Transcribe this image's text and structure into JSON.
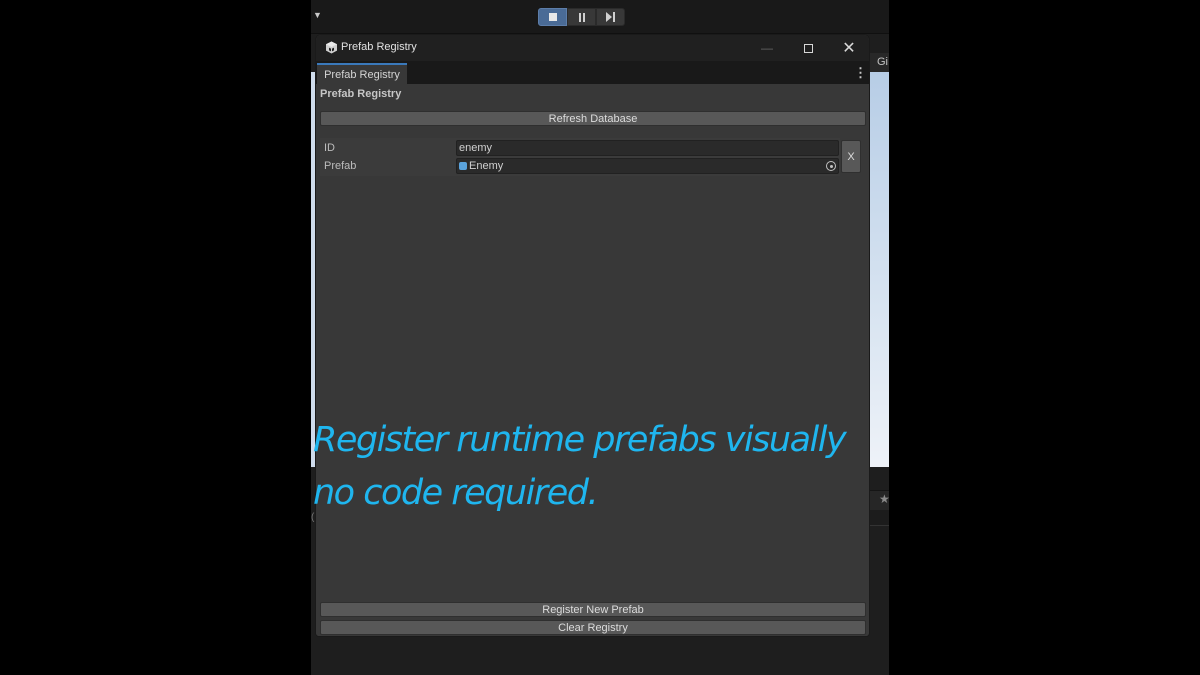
{
  "editor": {
    "toolbar": {
      "dropdown_icon": "caret-down-icon",
      "play_controls": [
        "stop-icon",
        "pause-icon",
        "step-icon"
      ]
    },
    "game_tab_label": "Gi",
    "lower_icon": "star-icon"
  },
  "window": {
    "title": "Prefab Registry",
    "title_icon": "prefab-cubes-icon",
    "controls": [
      "minimize-icon",
      "maximize-icon",
      "close-icon"
    ],
    "tab_label": "Prefab Registry",
    "menu_icon": "kebab-menu-icon"
  },
  "panel": {
    "heading": "Prefab Registry",
    "refresh_label": "Refresh Database",
    "entries": [
      {
        "id_label": "ID",
        "id_value": "enemy",
        "prefab_label": "Prefab",
        "prefab_value": "Enemy",
        "remove_label": "X"
      }
    ],
    "register_label": "Register New Prefab",
    "clear_label": "Clear Registry"
  },
  "tagline": {
    "line1": "Register runtime prefabs visually",
    "line2": "no code required."
  },
  "colors": {
    "tagline": "#1fb6ef",
    "window_bg": "#383838",
    "button_bg": "#585858",
    "tab_accent": "#3a79bb"
  }
}
